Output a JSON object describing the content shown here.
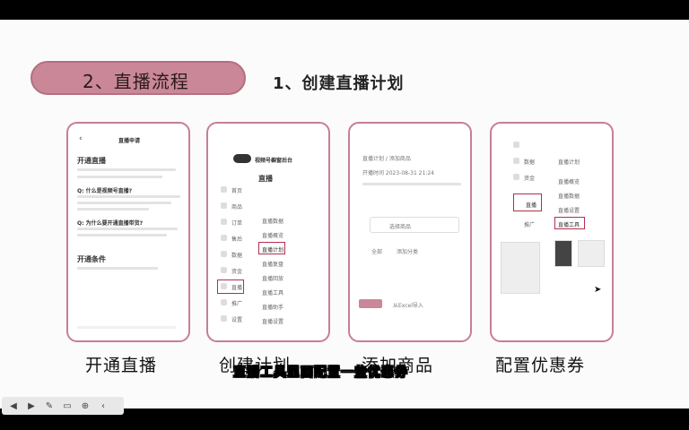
{
  "header": {
    "section": "2、直播流程",
    "step": "1、创建直播计划"
  },
  "cards": [
    {
      "label": "开通直播",
      "screen": {
        "header": "直播申请",
        "heading": "开通直播",
        "q1": "Q: 什么是视频号直播?",
        "q2": "Q: 为什么要开通直播带货?",
        "conditions": "开通条件"
      }
    },
    {
      "label": "创建计划",
      "screen": {
        "header": "视频号橱窗后台",
        "live": "直播",
        "nav": [
          "首页",
          "商品",
          "订单",
          "售后",
          "数据",
          "资金",
          "直播",
          "推广",
          "设置"
        ],
        "sub": [
          "直播数据",
          "直播概览",
          "直播计划",
          "直播复盘",
          "直播回放",
          "直播工具",
          "直播助手",
          "直播设置"
        ]
      }
    },
    {
      "label": "添加商品",
      "screen": {
        "breadcrumb": "直播计划 / 添加商品",
        "time": "开播时间 2023-08-31 21:24",
        "select": "选择商品",
        "tab_all": "全部",
        "tab_add": "添加分类",
        "import": "从Excel导入"
      }
    },
    {
      "label": "配置优惠券",
      "screen": {
        "nav": [
          "数据",
          "资金",
          "直播",
          "推广"
        ],
        "sub": [
          "直播计划",
          "直播概览",
          "直播数据",
          "直播设置",
          "直播工具"
        ]
      }
    }
  ],
  "subtitle": "直播工具里面配置一些优惠券",
  "colors": {
    "accent": "#c98797",
    "border": "#c67f95",
    "highlight": "#b0304e"
  }
}
